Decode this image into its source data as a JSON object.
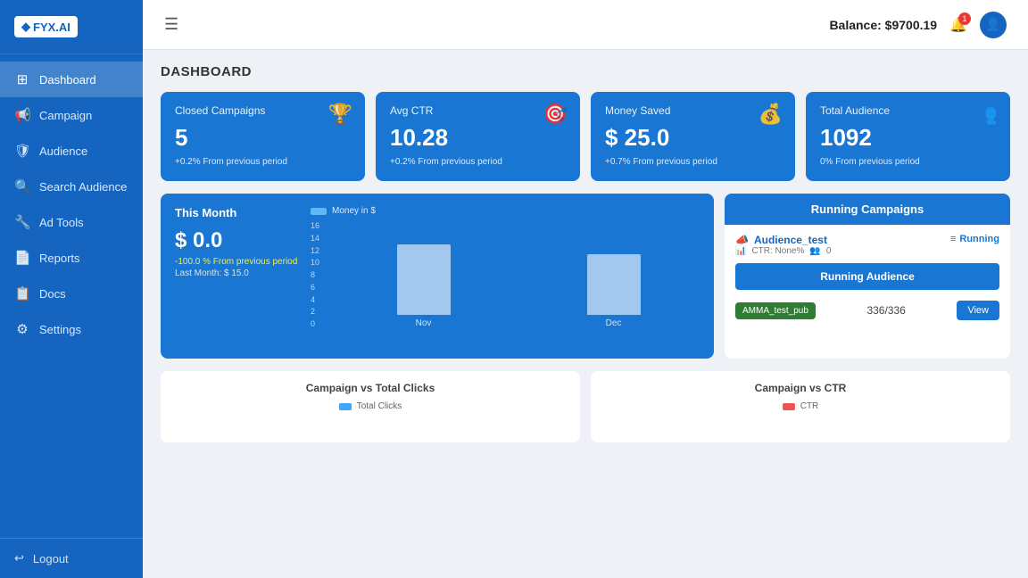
{
  "sidebar": {
    "logo": "FYX.AI",
    "items": [
      {
        "id": "dashboard",
        "label": "Dashboard",
        "icon": "⊞",
        "active": true
      },
      {
        "id": "campaign",
        "label": "Campaign",
        "icon": "📢"
      },
      {
        "id": "audience",
        "label": "Audience",
        "icon": "🛡"
      },
      {
        "id": "search-audience",
        "label": "Search Audience",
        "icon": "🔍"
      },
      {
        "id": "ad-tools",
        "label": "Ad Tools",
        "icon": "🔧"
      },
      {
        "id": "reports",
        "label": "Reports",
        "icon": "📄"
      },
      {
        "id": "docs",
        "label": "Docs",
        "icon": "📋"
      },
      {
        "id": "settings",
        "label": "Settings",
        "icon": "⚙"
      }
    ],
    "logout": "Logout"
  },
  "topbar": {
    "hamburger": "☰",
    "balance_label": "Balance: $9700.19",
    "notif_count": "1"
  },
  "dashboard": {
    "title": "DASHBOARD",
    "stats": [
      {
        "id": "closed-campaigns",
        "title": "Closed Campaigns",
        "value": "5",
        "change": "+0.2% From previous period",
        "icon": "🏆"
      },
      {
        "id": "avg-ctr",
        "title": "Avg CTR",
        "value": "10.28",
        "change": "+0.2% From previous period",
        "icon": "🎯"
      },
      {
        "id": "money-saved",
        "title": "Money Saved",
        "value": "$ 25.0",
        "change": "+0.7% From previous period",
        "icon": "💰"
      },
      {
        "id": "total-audience",
        "title": "Total Audience",
        "value": "1092",
        "change": "0% From previous period",
        "icon": "👥"
      }
    ],
    "this_month": {
      "title": "This Month",
      "value": "$ 0.0",
      "change": "-100.0 % From previous period",
      "last_month": "Last Month: $ 15.0",
      "chart_legend": "Money in $",
      "chart_y_labels": [
        "16",
        "14",
        "12",
        "10",
        "8",
        "6",
        "4",
        "2",
        "0"
      ],
      "bars": [
        {
          "label": "Nov",
          "height_pct": 72
        },
        {
          "label": "Dec",
          "height_pct": 62
        }
      ]
    },
    "running_campaigns": {
      "header": "Running Campaigns",
      "campaign_name": "Audience_test",
      "campaign_ctr": "CTR: None%",
      "campaign_count": "0",
      "status": "Running",
      "running_audience_header": "Running Audience",
      "audience_tag": "AMMA_test_pub",
      "audience_count": "336/336",
      "view_btn": "View"
    },
    "bottom_charts": [
      {
        "id": "campaign-vs-clicks",
        "title": "Campaign vs Total Clicks",
        "legend": "Total Clicks",
        "legend_color": "#42a5f5"
      },
      {
        "id": "campaign-vs-ctr",
        "title": "Campaign vs CTR",
        "legend": "CTR",
        "legend_color": "#ef5350"
      }
    ]
  }
}
